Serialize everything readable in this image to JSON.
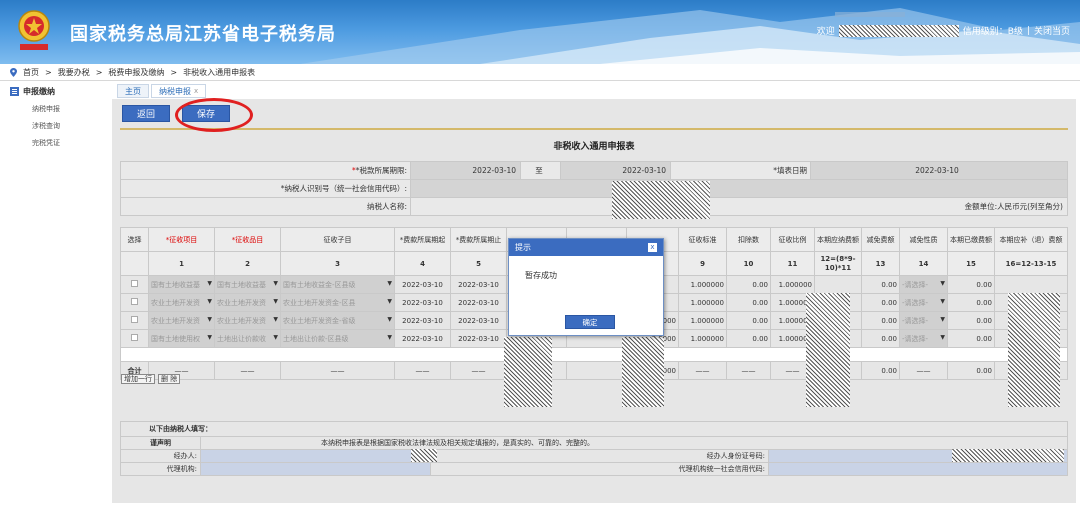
{
  "header": {
    "title": "国家税务总局江苏省电子税务局",
    "welcome": "欢迎",
    "credit": "信用级别：B级",
    "separator": "|",
    "close": "关闭当页"
  },
  "breadcrumb": [
    "首页",
    "我要办税",
    "税费申报及缴纳",
    "非税收入通用申报表"
  ],
  "breadcrumb_sep": ">",
  "sidebar": {
    "title": "申报缴纳",
    "items": [
      "纳税申报",
      "涉税查询",
      "完税凭证"
    ]
  },
  "tabs": [
    "主页",
    "纳税申报"
  ],
  "tab_close": "x",
  "toolbar": {
    "back": "返回",
    "save": "保存"
  },
  "form": {
    "title": "非税收入通用申报表",
    "period_label": "*税款所属期限:",
    "period_start": "2022-03-10",
    "to": "至",
    "period_end": "2022-03-10",
    "fill_date_label": "*填表日期",
    "fill_date": "2022-03-10",
    "taxpayer_id_label": "*纳税人识别号（统一社会信用代码）:",
    "taxpayer_name_label": "纳税人名称:",
    "unit_label": "金额单位:人民币元(列至角分)"
  },
  "grid": {
    "headers": [
      "选择",
      "*征收项目",
      "*征收品目",
      "征收子目",
      "*费款所属期起",
      "*费款所属期止",
      "",
      "",
      "",
      "征收标准",
      "扣除数",
      "征收比例",
      "本期应纳费额",
      "减免费额",
      "减免性质",
      "本期已缴费额",
      "本期应补（退）费额"
    ],
    "numbers": [
      "",
      "1",
      "2",
      "3",
      "4",
      "5",
      "",
      "",
      "",
      "9",
      "10",
      "11",
      "12=(8*9-10)*11",
      "13",
      "14",
      "15",
      "16=12-13-15"
    ],
    "rows": [
      {
        "item": "国有土地收益基",
        "cat": "国有土地收益基",
        "sub": "国有土地收益金-区县级",
        "start": "2022-03-10",
        "end": "2022-03-10",
        "std": "1.000000",
        "ded": "0.00",
        "ratio": "1.000000",
        "mid": "",
        "red": "0.00",
        "nature": "-请选择-",
        "paid": "0.00"
      },
      {
        "item": "农业土地开发资",
        "cat": "农业土地开发资",
        "sub": "农业土地开发资金-区县",
        "start": "2022-03-10",
        "end": "2022-03-10",
        "std": "1.000000",
        "ded": "0.00",
        "ratio": "1.000000",
        "mid": "",
        "red": "0.00",
        "nature": "-请选择-",
        "paid": "0.00"
      },
      {
        "item": "农业土地开发资",
        "cat": "农业土地开发资",
        "sub": "农业土地开发资金-省级",
        "start": "2022-03-10",
        "end": "2022-03-10",
        "std": "1.000000",
        "ded": "0.00",
        "ratio": "1.000000",
        "mid": "0.0000",
        "red": "0.00",
        "nature": "-请选择-",
        "paid": "0.00"
      },
      {
        "item": "国有土地使用权",
        "cat": "土地出让价款收",
        "sub": "土地出让价款-区县级",
        "start": "2022-03-10",
        "end": "2022-03-10",
        "std": "1.000000",
        "ded": "0.00",
        "ratio": "1.000000",
        "mid": "0.0000",
        "red": "0.00",
        "nature": "-请选择-",
        "paid": "0.00"
      }
    ],
    "add_row": "增加一行",
    "delete": "删 除",
    "total_label": "合计",
    "total_mid": "0.0000",
    "total_red": "0.00",
    "total_paid": "0.00",
    "dash": "——"
  },
  "footer": {
    "fill_by": "以下由纳税人填写：",
    "declaration_label": "谨声明",
    "declaration": "本纳税申报表是根据国家税收法律法规及相关规定填报的，是真实的、可靠的、完整的。",
    "handler_label": "经办人:",
    "handler_id_label": "经办人身份证号码:",
    "agency_label": "代理机构:",
    "agency_code_label": "代理机构统一社会信用代码:"
  },
  "dialog": {
    "title": "提示",
    "close": "x",
    "message": "暂存成功",
    "ok": "确定"
  },
  "colors": {
    "primary": "#3b6cc0",
    "highlight_ring": "#e02020",
    "header_bg": "#2c7cc7"
  }
}
